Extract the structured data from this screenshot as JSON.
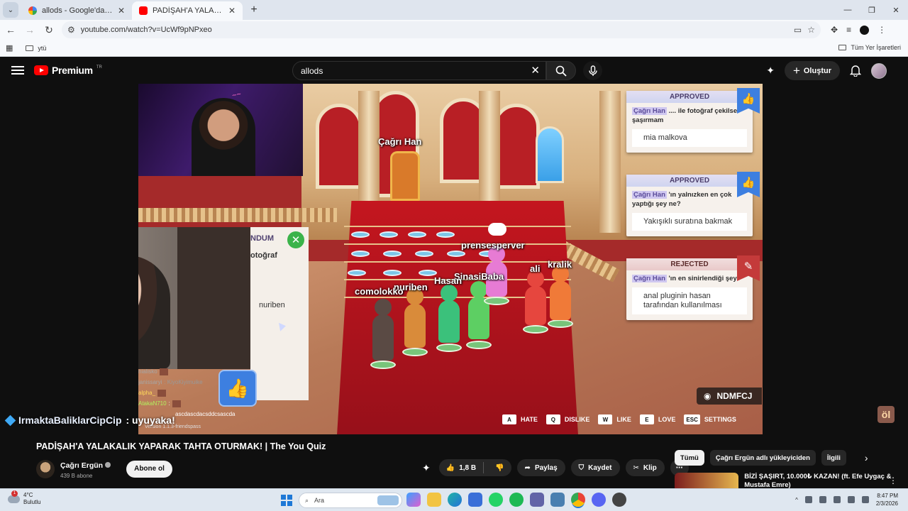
{
  "browser": {
    "tabs": [
      {
        "title": "allods - Google'da Ara",
        "active": false
      },
      {
        "title": "PADİŞAH'A YALAKALIK YAPARAK TAHTA OTURMAK! | The You Quiz",
        "active": true
      }
    ],
    "url": "youtube.com/watch?v=UcWf9pNPxeo",
    "bookmark": "ytü",
    "all_bookmarks": "Tüm Yer İşaretleri"
  },
  "youtube": {
    "logo": "Premium",
    "country": "TR",
    "search_value": "allods",
    "create_label": "Oluştur"
  },
  "video": {
    "scene_labels": {
      "throne": "Çağrı Han",
      "players": [
        "prensesperver",
        "SinasiBaba",
        "Hasan",
        "nuriben",
        "comolokko",
        "ali",
        "kralik"
      ]
    },
    "left_card": {
      "status": "NDUM",
      "question": "otoğraf",
      "answer": "nuriben"
    },
    "questions": [
      {
        "status": "APPROVED",
        "name": "Çağrı Han",
        "text": " .... ile fotoğraf çekilse şaşırmam",
        "answer": "mia malkova"
      },
      {
        "status": "APPROVED",
        "name": "Çağrı Han",
        "text": " 'ın yalnızken en çok yaptığı şey ne?",
        "answer": "Yakışıklı suratına bakmak"
      },
      {
        "status": "REJECTED",
        "name": "Çağrı Han",
        "text": " 'ın en sinirlendiği şey",
        "answer": "anal pluginin hasan tarafından kullanılması"
      }
    ],
    "room_code": "NDMFCJ",
    "key_hints": [
      {
        "key": "A",
        "label": "HATE"
      },
      {
        "key": "Q",
        "label": "DISLIKE"
      },
      {
        "key": "W",
        "label": "LIKE"
      },
      {
        "key": "E",
        "label": "LOVE"
      },
      {
        "key": "ESC",
        "label": "SETTINGS"
      }
    ],
    "chat": [
      {
        "user": "nialisko",
        "msg": ""
      },
      {
        "user": "janissaryi",
        "msg": ": KiyoKiyimuike"
      },
      {
        "user": "alpha_",
        "msg": ""
      },
      {
        "user": "AtakaN710",
        "msg": ":"
      },
      {
        "user": "",
        "msg": "ascdascdacsddcsascda"
      }
    ],
    "version": "Version 1.1.3-friendspass",
    "caption_user": "IrmaktaBaliklarCipCip",
    "caption_msg": ": uyuyaka!",
    "corner_logo": "öl"
  },
  "meta": {
    "title": "PADİŞAH'A YALAKALIK YAPARAK TAHTA OTURMAK! | The You Quiz",
    "channel": "Çağrı Ergün",
    "subs": "439 B abone",
    "subscribe": "Abone ol",
    "likes": "1,8 B",
    "share": "Paylaş",
    "save": "Kaydet",
    "clip": "Klip",
    "chips": [
      "Tümü",
      "Çağrı Ergün adlı yükleyiciden",
      "İlgili"
    ],
    "reco_title": "BİZİ ŞAŞIRT, 10.000₺ KAZAN! (ft. Efe Uygaç & Mustafa Emre)"
  },
  "taskbar": {
    "temp": "4°C",
    "weather": "Bulutlu",
    "search": "Ara",
    "time": "8:47 PM",
    "date": "2/3/2026"
  },
  "colors": {
    "yt_red": "#ff0000",
    "approved_thumb": "#3d7fe0",
    "rejected_thumb": "#c43a3a",
    "carpet": "#c4161f"
  }
}
